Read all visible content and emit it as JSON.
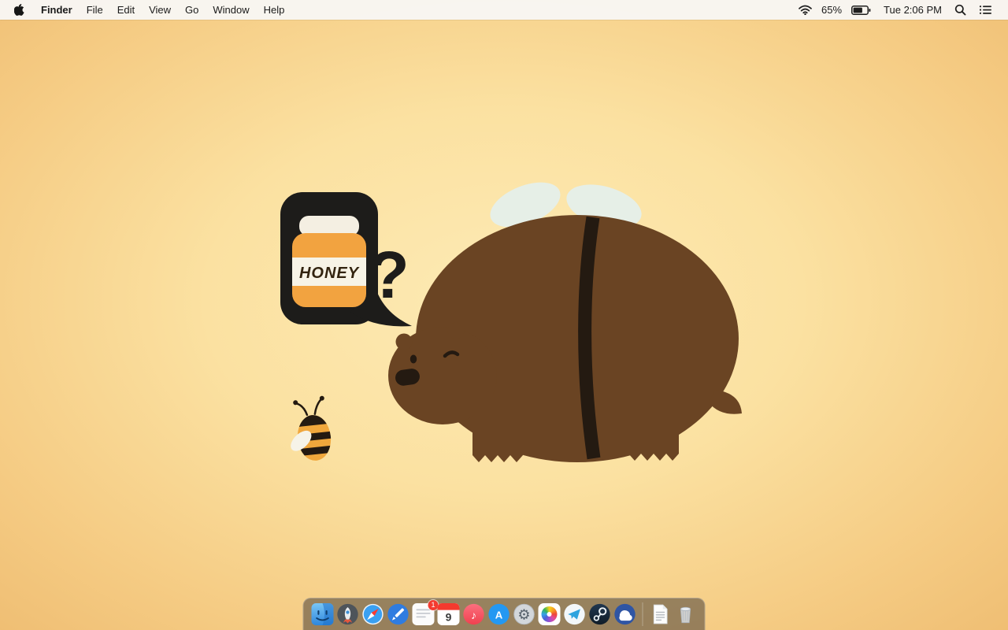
{
  "menubar": {
    "app_menu_items": [
      "Finder",
      "File",
      "Edit",
      "View",
      "Go",
      "Window",
      "Help"
    ],
    "status": {
      "battery_percent": "65%",
      "clock": "Tue 2:06 PM"
    }
  },
  "wallpaper": {
    "honey_label": "HONEY",
    "question_mark": "?",
    "colors": {
      "background_center": "#fdeab4",
      "background_edge": "#edb96d",
      "bear_body": "#6a4423",
      "bear_dark": "#241a11",
      "wings": "#e6efe7",
      "speech_bubble": "#1d1c1a",
      "honey_jar": "#f2a340",
      "bee_yellow": "#f0a73c"
    }
  },
  "dock": {
    "items": [
      "finder",
      "launchpad",
      "safari",
      "pencil-app",
      "mail",
      "calendar",
      "itunes",
      "app-store",
      "system-preferences",
      "photos",
      "chat-app",
      "steam",
      "cloud-app",
      "textedit",
      "trash"
    ],
    "calendar_day": "9",
    "mail_badge": "1",
    "appstore_letter": "A",
    "itunes_glyph": "♪",
    "prefs_glyph": "⚙"
  }
}
